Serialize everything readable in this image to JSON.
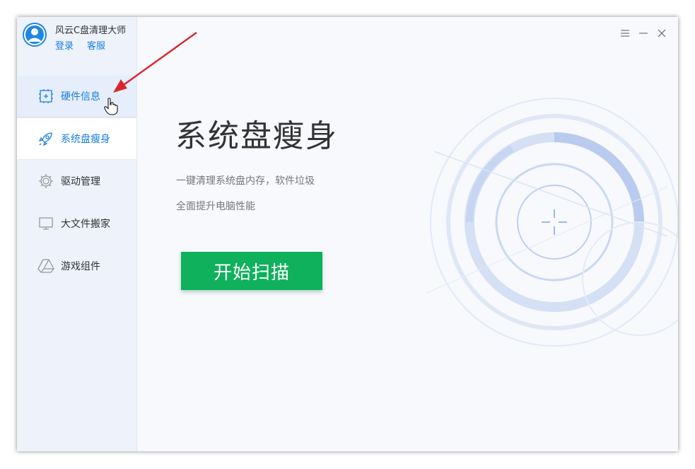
{
  "app": {
    "title": "风云C盘清理大师",
    "login_label": "登录",
    "service_label": "客服"
  },
  "sidebar": {
    "items": [
      {
        "label": "硬件信息",
        "icon": "hardware-icon",
        "state": "hover"
      },
      {
        "label": "系统盘瘦身",
        "icon": "rocket-icon",
        "state": "active"
      },
      {
        "label": "驱动管理",
        "icon": "gear-icon",
        "state": "normal"
      },
      {
        "label": "大文件搬家",
        "icon": "monitor-icon",
        "state": "normal"
      },
      {
        "label": "游戏组件",
        "icon": "drive-icon",
        "state": "normal"
      }
    ]
  },
  "window_controls": {
    "menu_icon": "menu-icon",
    "minimize_icon": "minimize-icon",
    "close_icon": "close-icon"
  },
  "main": {
    "title": "系统盘瘦身",
    "desc_line1": "一键清理系统盘内存，软件垃圾",
    "desc_line2": "全面提升电脑性能",
    "scan_button": "开始扫描"
  },
  "colors": {
    "accent": "#1a7fe0",
    "scan_button": "#0fb15c",
    "sidebar_bg": "#edf2fb",
    "annotation_arrow": "#d9262b"
  }
}
